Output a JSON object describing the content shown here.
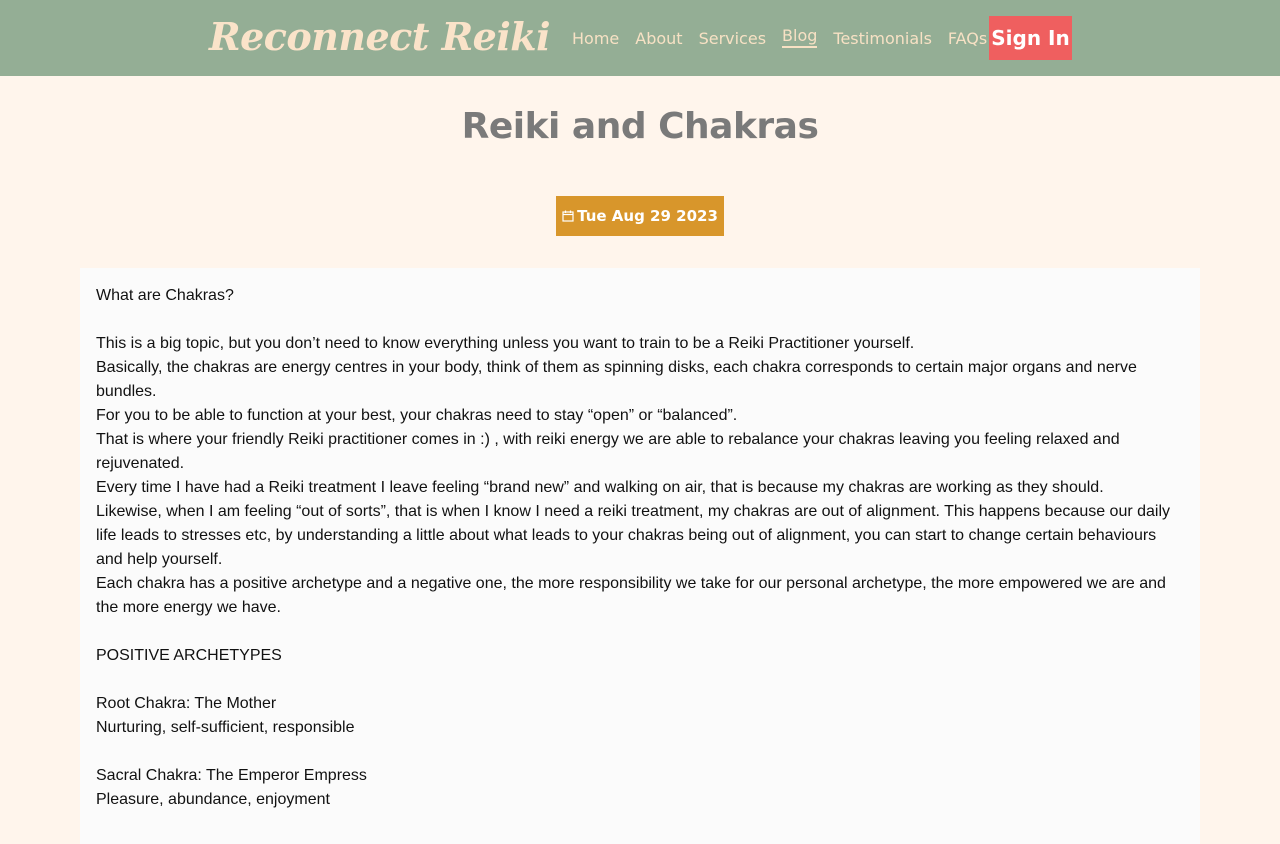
{
  "brand": "Reconnect Reiki",
  "nav": {
    "items": [
      "Home",
      "About",
      "Services",
      "Blog",
      "Testimonials",
      "FAQs"
    ],
    "active": "Blog",
    "sign_in": "Sign In"
  },
  "post": {
    "title": "Reiki and Chakras",
    "date": "Tue Aug 29 2023",
    "paragraphs": [
      "What are Chakras?",
      "",
      "This is a big topic, but you don’t need to know everything unless you want to train to be a Reiki Practitioner yourself.",
      "Basically, the chakras are energy centres in your body, think of them as spinning disks, each chakra corresponds to certain major organs and nerve bundles.",
      "For you to be able to function at your best, your chakras need to stay “open” or “balanced”.",
      "That is where your friendly Reiki practitioner comes in :) , with reiki energy we are able to rebalance your chakras leaving you feeling relaxed and rejuvenated.",
      "Every time I have had a Reiki treatment I leave feeling “brand new” and walking on air, that is because my chakras are working as they should.",
      "Likewise, when I am feeling “out of sorts”, that is when I know I need a reiki treatment, my chakras are out of alignment. This happens because our daily life leads to stresses etc, by understanding a little about what leads to your chakras being out of alignment, you can start to change certain behaviours and help yourself.",
      "Each chakra has a positive archetype and a negative one, the more responsibility we take for our personal archetype, the more empowered we are and the more energy we have.",
      "",
      "POSITIVE ARCHETYPES",
      "",
      "Root Chakra: The Mother",
      "Nurturing, self-sufficient, responsible",
      "",
      "Sacral Chakra: The Emperor Empress",
      "Pleasure, abundance, enjoyment"
    ]
  },
  "colors": {
    "nav_bg": "#94ae95",
    "nav_text": "#f7e1c4",
    "sign_in_bg": "#ef5f5f",
    "date_badge_bg": "#d8962b",
    "page_bg": "#fff5ec",
    "title_color": "#7a7a7a"
  },
  "icons": {
    "date": "calendar-icon"
  }
}
